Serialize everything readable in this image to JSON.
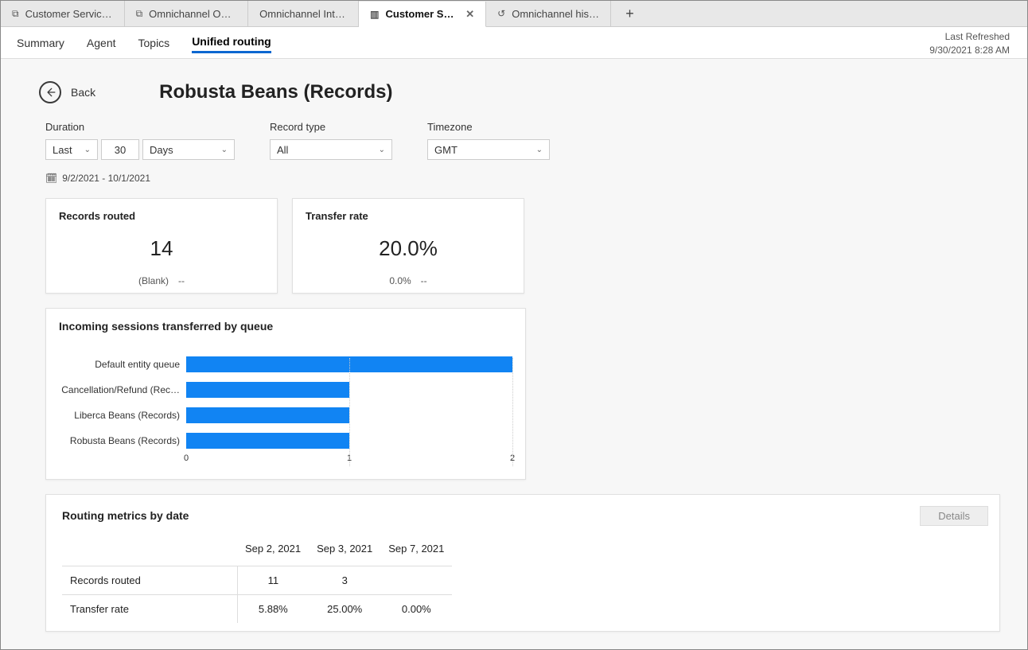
{
  "tabs": [
    {
      "label": "Customer Service A…"
    },
    {
      "label": "Omnichannel Ong…"
    },
    {
      "label": "Omnichannel Intraday…"
    },
    {
      "label": "Customer Service historic…",
      "active": true,
      "closeable": true
    },
    {
      "label": "Omnichannel histo…"
    }
  ],
  "subnav": [
    "Summary",
    "Agent",
    "Topics",
    "Unified routing"
  ],
  "subnav_active": 3,
  "refresh": {
    "label": "Last Refreshed",
    "value": "9/30/2021 8:28 AM"
  },
  "back_label": "Back",
  "page_title": "Robusta Beans (Records)",
  "filters": {
    "duration": {
      "label": "Duration",
      "period": "Last",
      "count": "30",
      "unit": "Days"
    },
    "record_type": {
      "label": "Record type",
      "value": "All"
    },
    "timezone": {
      "label": "Timezone",
      "value": "GMT"
    }
  },
  "date_range": "9/2/2021 - 10/1/2021",
  "cards": {
    "records_routed": {
      "title": "Records routed",
      "value": "14",
      "sub": "(Blank)",
      "trend": "--"
    },
    "transfer_rate": {
      "title": "Transfer rate",
      "value": "20.0%",
      "sub": "0.0%",
      "trend": "--"
    }
  },
  "chart_data": {
    "type": "bar",
    "title": "Incoming sessions transferred by queue",
    "categories": [
      "Default entity queue",
      "Cancellation/Refund (Rec…",
      "Liberca Beans (Records)",
      "Robusta Beans (Records)"
    ],
    "values": [
      2,
      1,
      1,
      1
    ],
    "x_ticks": [
      0,
      1,
      2
    ],
    "xlim": [
      0,
      2
    ]
  },
  "table": {
    "title": "Routing metrics by date",
    "columns": [
      "",
      "Sep 2, 2021",
      "Sep 3, 2021",
      "Sep 7, 2021"
    ],
    "rows": [
      {
        "label": "Records routed",
        "cells": [
          "11",
          "3",
          ""
        ]
      },
      {
        "label": "Transfer rate",
        "cells": [
          "5.88%",
          "25.00%",
          "0.00%"
        ]
      }
    ],
    "details_btn": "Details"
  }
}
